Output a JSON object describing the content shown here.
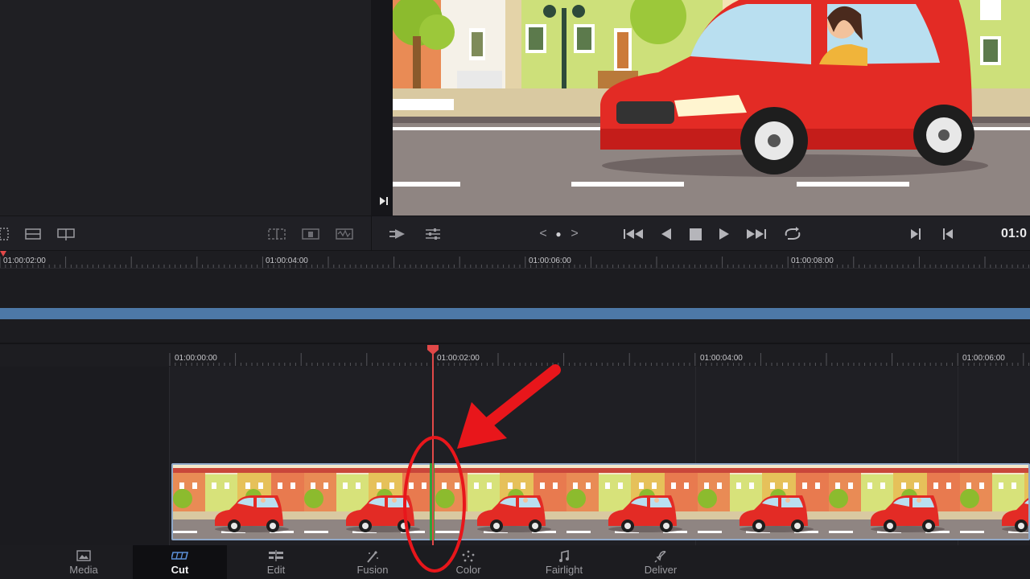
{
  "viewer": {
    "jump_to_end_icon": "skip-to-end-icon"
  },
  "toolbar": {
    "left_icons": [
      "safe-area-icon",
      "single-viewer-icon",
      "dual-viewer-icon"
    ],
    "mid_icons": [
      "split-clip-icon",
      "trim-view-icon",
      "audio-waveform-icon"
    ],
    "transport": {
      "prev_marker": "<",
      "dot": "●",
      "next_marker": ">"
    },
    "timecode": "01:0"
  },
  "upper_timeline": {
    "ruler_labels": [
      "01:00:02:00",
      "01:00:04:00",
      "01:00:06:00",
      "01:00:08:00"
    ],
    "overview_color": "#4d78a7"
  },
  "main_timeline": {
    "ruler_labels": [
      "01:00:00:00",
      "01:00:02:00",
      "01:00:04:00",
      "01:00:06:00"
    ],
    "playhead_color": "#e14848",
    "cut_marker_color": "#2fa23c"
  },
  "page_tabs": [
    {
      "label": "Media",
      "icon": "media-page-icon"
    },
    {
      "label": "Cut",
      "icon": "cut-page-icon",
      "active": true
    },
    {
      "label": "Edit",
      "icon": "edit-page-icon"
    },
    {
      "label": "Fusion",
      "icon": "fusion-page-icon"
    },
    {
      "label": "Color",
      "icon": "color-page-icon"
    },
    {
      "label": "Fairlight",
      "icon": "fairlight-page-icon"
    },
    {
      "label": "Deliver",
      "icon": "deliver-page-icon"
    }
  ],
  "annotation": {
    "color": "#e8161b"
  }
}
